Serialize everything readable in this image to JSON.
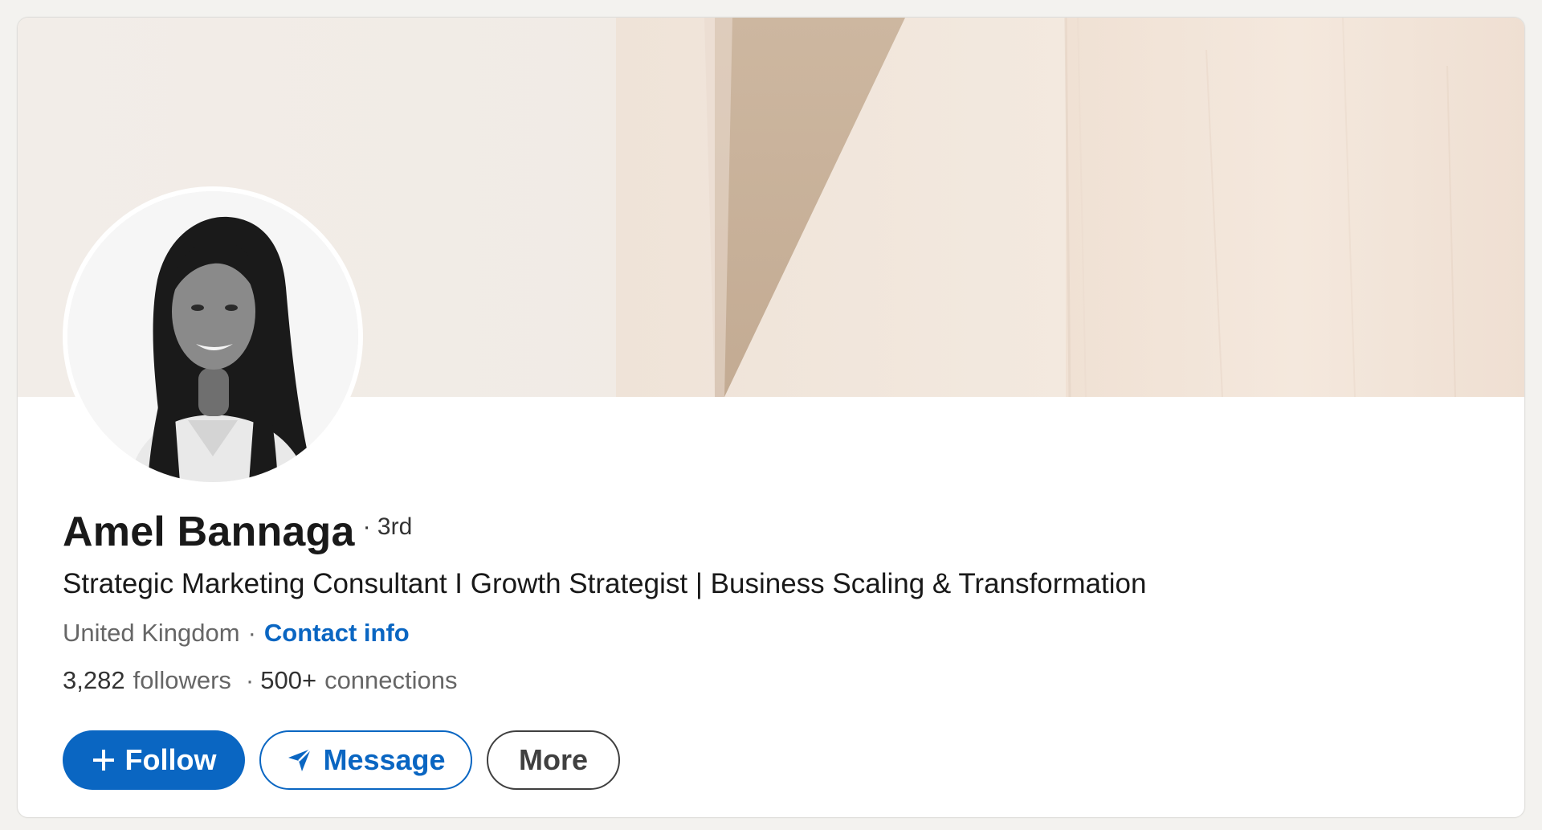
{
  "profile": {
    "name": "Amel Bannaga",
    "degree": "· 3rd",
    "headline": "Strategic Marketing Consultant I Growth Strategist | Business Scaling & Transformation",
    "location": "United Kingdom",
    "location_separator": "·",
    "contact_label": "Contact info",
    "followers_count": "3,282",
    "followers_label": "followers",
    "connections_separator": "·",
    "connections_count": "500+",
    "connections_label": "connections"
  },
  "actions": {
    "follow_label": "Follow",
    "follow_icon": "plus-icon",
    "message_label": "Message",
    "message_icon": "send-icon",
    "more_label": "More"
  },
  "colors": {
    "accent": "#0a66c2",
    "background": "#f3f2ef",
    "banner": "#eee6dd"
  }
}
